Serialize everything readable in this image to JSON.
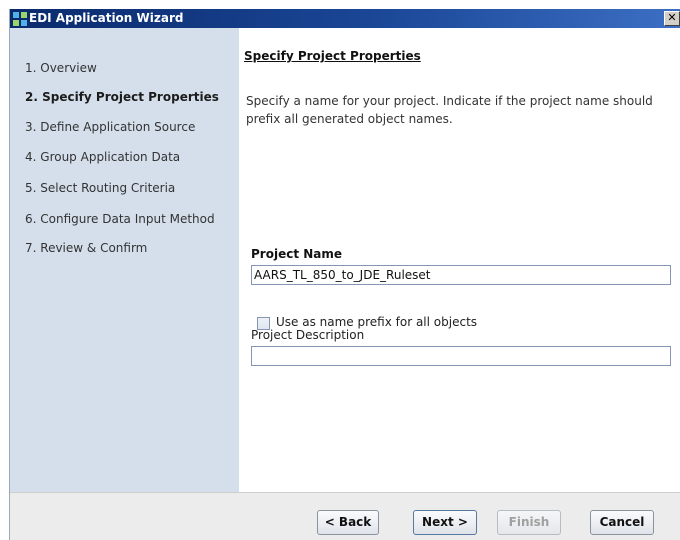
{
  "window": {
    "title": "EDI Application Wizard",
    "close_glyph": "✕"
  },
  "sidebar": {
    "steps": [
      {
        "label": "1. Overview"
      },
      {
        "label": "2. Specify Project Properties",
        "active": true
      },
      {
        "label": "3. Define Application Source"
      },
      {
        "label": "4. Group Application Data"
      },
      {
        "label": "5. Select Routing Criteria"
      },
      {
        "label": "6. Configure Data Input Method"
      },
      {
        "label": "7. Review & Confirm"
      }
    ]
  },
  "main": {
    "heading": "Specify Project Properties",
    "description": "Specify a name for your project.  Indicate if the project name should prefix all generated object names.",
    "project_name_label": "Project Name",
    "project_name_value": "AARS_TL_850_to_JDE_Ruleset",
    "prefix_checkbox_label": "Use as name prefix for all objects",
    "prefix_checked": false,
    "project_description_label": "Project Description",
    "project_description_value": ""
  },
  "footer": {
    "back_label": "< Back",
    "next_label": "Next >",
    "finish_label": "Finish",
    "finish_disabled": true,
    "cancel_label": "Cancel"
  },
  "icons": {
    "app": "wizard-app-icon",
    "close": "close-icon"
  }
}
